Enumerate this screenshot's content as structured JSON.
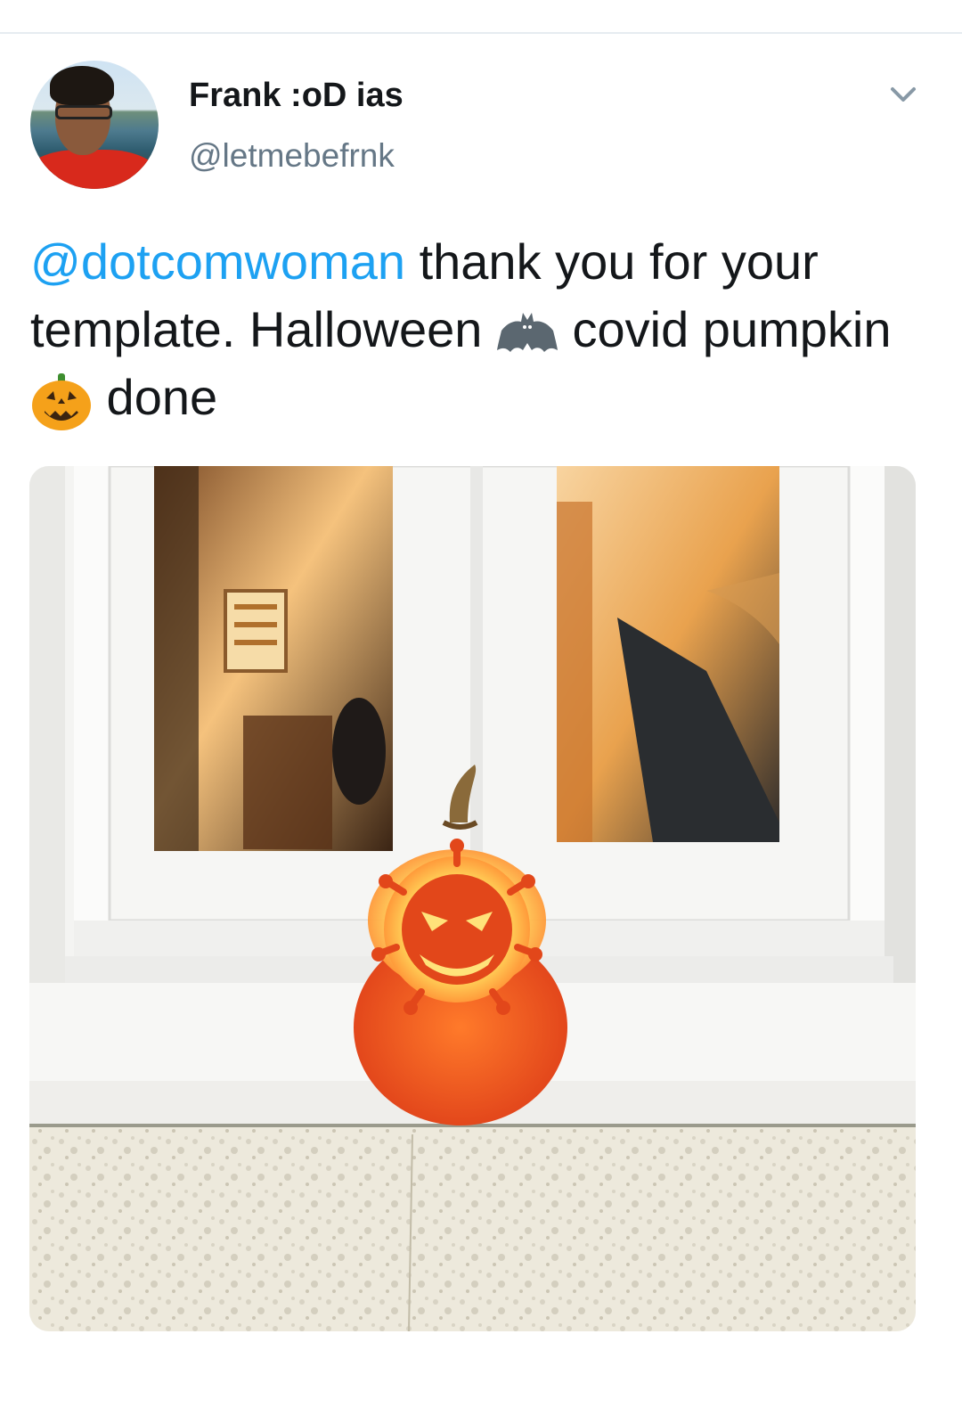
{
  "tweet": {
    "author": {
      "display_name": "Frank :oD ias",
      "handle": "@letmebefrnk",
      "avatar_icon": "profile-photo"
    },
    "menu_icon": "chevron-down-icon",
    "text": {
      "mention": "@dotcomwoman",
      "part1": " thank you for your template. Halloween ",
      "bat_emoji": "bat-emoji",
      "part2": " covid pumpkin ",
      "pumpkin_emoji": "jack-o-lantern-emoji",
      "part3": " done"
    },
    "media": {
      "type": "photo",
      "description_icon": "carved-pumpkin-photo"
    }
  },
  "colors": {
    "mention": "#1da1f2",
    "text": "#14171a",
    "secondary": "#657786",
    "divider": "#e6ecf0"
  }
}
